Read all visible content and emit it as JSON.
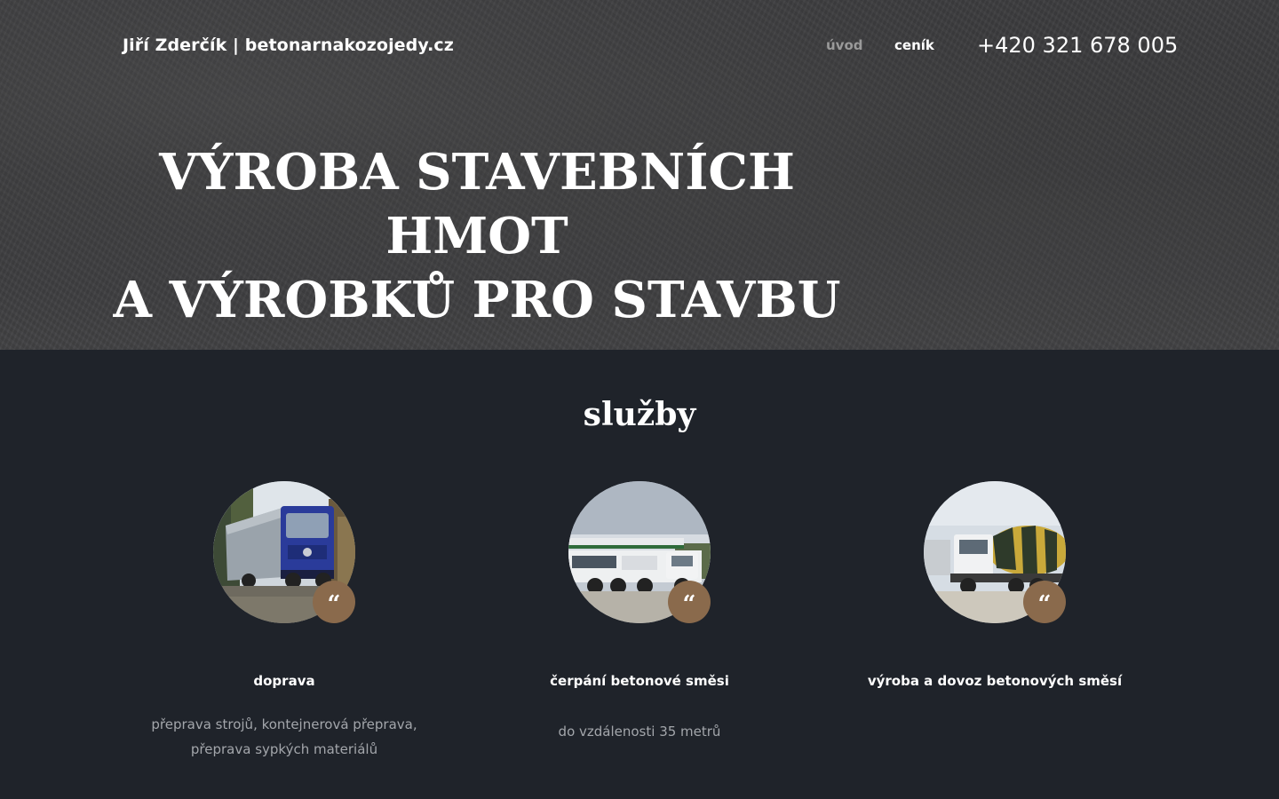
{
  "header": {
    "brand": "Jiří Zderčík | betonarnakozojedy.cz",
    "nav": [
      {
        "label": "úvod",
        "active": true
      },
      {
        "label": "ceník",
        "active": false
      }
    ],
    "phone": "+420 321 678 005"
  },
  "hero": {
    "title_line1": "VÝROBA STAVEBNÍCH HMOT",
    "title_line2": "A VÝROBKŮ PRO STAVBU"
  },
  "services": {
    "title": "služby",
    "items": [
      {
        "title": "doprava",
        "text": "přeprava strojů, kontejnerová přeprava, přeprava sypkých materiálů",
        "image_icon": "blue-truck-photo",
        "badge": "“"
      },
      {
        "title": "čerpání betonové směsi",
        "text": "do vzdálenosti 35 metrů",
        "image_icon": "concrete-pump-truck-photo",
        "badge": "“"
      },
      {
        "title": "výroba a dovoz betonových směsí",
        "text": "",
        "image_icon": "concrete-mixer-truck-photo",
        "badge": "“"
      }
    ]
  },
  "colors": {
    "accent_badge": "#8a6a4c",
    "section_bg": "#1f232a",
    "muted_text": "#a3a6ab"
  }
}
